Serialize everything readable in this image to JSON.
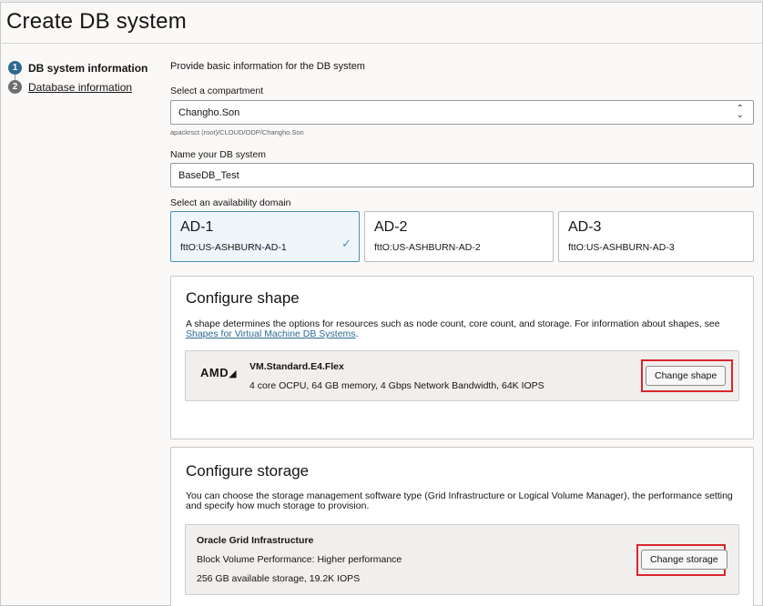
{
  "page": {
    "title": "Create DB system"
  },
  "steps": [
    {
      "number": "1",
      "label": "DB system information"
    },
    {
      "number": "2",
      "label": "Database information"
    }
  ],
  "intro": "Provide basic information for the DB system",
  "compartment": {
    "label": "Select a compartment",
    "value": "Changho.Son",
    "path": "apackrsct (root)/CLOUD/ODP/Changho.Son"
  },
  "db_name": {
    "label": "Name your DB system",
    "value": "BaseDB_Test"
  },
  "availability": {
    "label": "Select an availability domain",
    "domains": [
      {
        "name": "AD-1",
        "detail": "fttO:US-ASHBURN-AD-1",
        "selected": true
      },
      {
        "name": "AD-2",
        "detail": "fttO:US-ASHBURN-AD-2",
        "selected": false
      },
      {
        "name": "AD-3",
        "detail": "fttO:US-ASHBURN-AD-3",
        "selected": false
      }
    ]
  },
  "shape": {
    "heading": "Configure shape",
    "description": "A shape determines the options for resources such as node count, core count, and storage. For information about shapes, see",
    "link": "Shapes for Virtual Machine DB Systems",
    "vendor_logo": "AMD",
    "name": "VM.Standard.E4.Flex",
    "specs": "4 core OCPU, 64 GB memory, 4 Gbps Network Bandwidth, 64K IOPS",
    "button": "Change shape"
  },
  "storage": {
    "heading": "Configure storage",
    "description": "You can choose the storage management software type (Grid Infrastructure or Logical Volume Manager), the performance setting and specify how much storage to provision.",
    "type": "Oracle Grid Infrastructure",
    "performance": "Block Volume Performance: Higher performance",
    "capacity": "256 GB available storage, 19.2K IOPS",
    "button": "Change storage"
  },
  "colors": {
    "accent": "#2c6a90",
    "highlight": "#d9262c",
    "selected_border": "#4a8fb8"
  }
}
